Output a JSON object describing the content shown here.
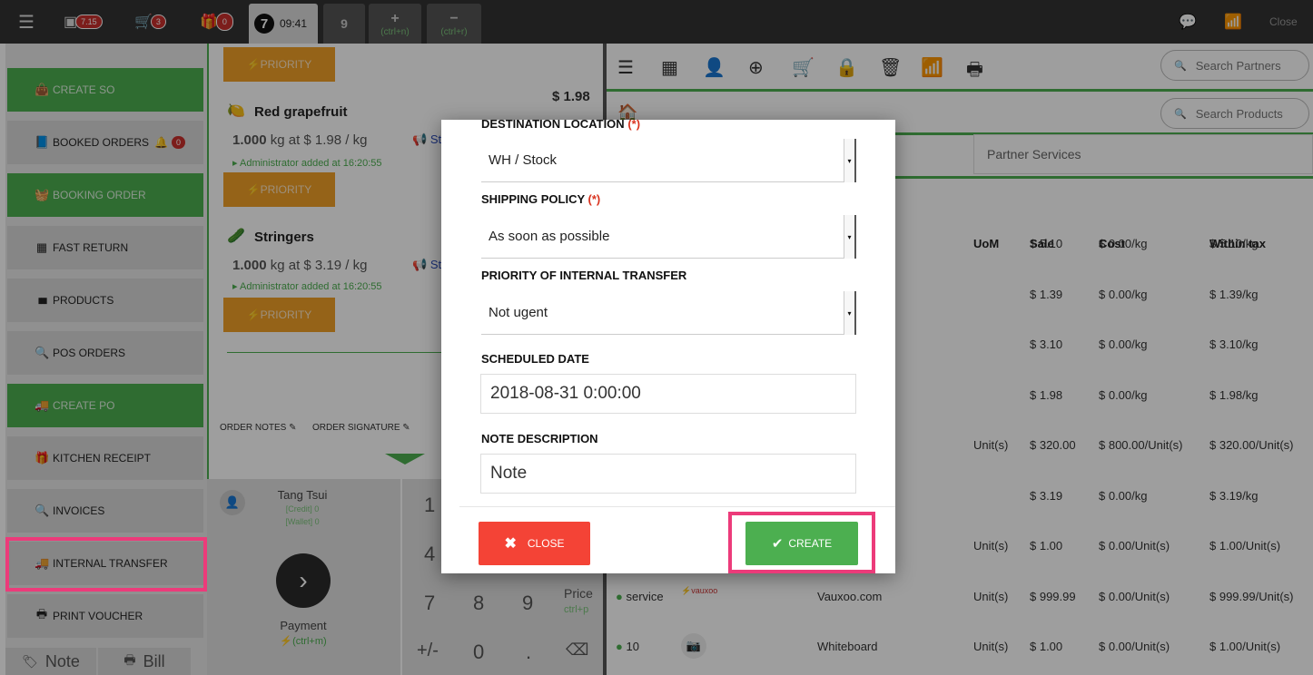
{
  "topbar": {
    "cash_badge": "7.15",
    "cart_badge": "3",
    "gift_badge": "0",
    "order_number": "7",
    "order_time": "09:41",
    "order_tab_2": "9",
    "add_shortcut": "(ctrl+n)",
    "remove_shortcut": "(ctrl+r)",
    "close_label": "Close"
  },
  "sidebar": {
    "items": [
      {
        "label": "CREATE SO",
        "icon": "shopping-bag-icon",
        "glyph": "👜"
      },
      {
        "label": "BOOKED ORDERS",
        "icon": "book-icon",
        "glyph": "📘"
      },
      {
        "label": "BOOKING ORDER",
        "icon": "basket-icon",
        "glyph": "🧺"
      },
      {
        "label": "FAST RETURN",
        "icon": "building-icon",
        "glyph": "▦"
      },
      {
        "label": "PRODUCTS",
        "icon": "barcode-icon",
        "glyph": "▮▮▮"
      },
      {
        "label": "POS ORDERS",
        "icon": "search-icon",
        "glyph": "🔍"
      },
      {
        "label": "CREATE PO",
        "icon": "truck-icon",
        "glyph": "🚚"
      },
      {
        "label": "KITCHEN RECEIPT",
        "icon": "gift-icon",
        "glyph": "🎁"
      },
      {
        "label": "INVOICES",
        "icon": "search-icon",
        "glyph": "🔍"
      },
      {
        "label": "INTERNAL TRANSFER",
        "icon": "truck-icon",
        "glyph": "🚚"
      },
      {
        "label": "PRINT VOUCHER",
        "icon": "print-icon",
        "glyph": "🖶"
      }
    ],
    "booked_badge": "0",
    "note_label": "Note",
    "bill_label": "Bill"
  },
  "order": {
    "priority_label": "PRIORITY",
    "total": "$ 1.98",
    "lines": [
      {
        "name": "Red grapefruit",
        "qty": "1.000",
        "unit_text": "kg at $ 1.98 / kg",
        "admin": "Administrator added at 16:20:55",
        "status": "Sta"
      },
      {
        "name": "Stringers",
        "qty": "1.000",
        "unit_text": "kg at $ 3.19 / kg",
        "admin": "Administrator added at 16:20:55",
        "status": "Sta"
      }
    ],
    "order_notes": "ORDER NOTES",
    "order_signature": "ORDER SIGNATURE"
  },
  "customer": {
    "name": "Tang Tsui",
    "credit": "[Credit] 0",
    "wallet": "[Wallet] 0",
    "payment_label": "Payment",
    "payment_shortcut": "(ctrl+m)"
  },
  "numpad": {
    "keys": [
      "1",
      "4",
      "7",
      "8",
      "9",
      "+/-",
      "0",
      "."
    ],
    "price_label": "Price",
    "price_shortcut": "ctrl+p"
  },
  "right": {
    "search_partners": "Search Partners",
    "search_products": "Search Products",
    "partner_services": "Partner Services",
    "columns": [
      "UoM",
      "Sale",
      "Cost",
      "Within tax"
    ],
    "rows": [
      {
        "uom": "",
        "sale": "$ 5.10",
        "cost": "$ 0.00/kg",
        "tax": "$ 5.10/kg"
      },
      {
        "uom": "",
        "sale": "$ 1.39",
        "cost": "$ 0.00/kg",
        "tax": "$ 1.39/kg"
      },
      {
        "uom": "",
        "sale": "$ 3.10",
        "cost": "$ 0.00/kg",
        "tax": "$ 3.10/kg"
      },
      {
        "uom": "",
        "sale": "$ 1.98",
        "cost": "$ 0.00/kg",
        "tax": "$ 1.98/kg"
      },
      {
        "uom": "Unit(s)",
        "sale": "$ 320.00",
        "cost": "$ 800.00/Unit(s)",
        "tax": "$ 320.00/Unit(s)"
      },
      {
        "uom": "",
        "sale": "$ 3.19",
        "cost": "$ 0.00/kg",
        "tax": "$ 3.19/kg"
      },
      {
        "uom": "Unit(s)",
        "sale": "$ 1.00",
        "cost": "$ 0.00/Unit(s)",
        "tax": "$ 1.00/Unit(s)"
      },
      {
        "code": "service",
        "name": "Vauxoo.com",
        "uom": "Unit(s)",
        "sale": "$ 999.99",
        "cost": "$ 0.00/Unit(s)",
        "tax": "$ 999.99/Unit(s)"
      },
      {
        "code": "10",
        "name": "Whiteboard",
        "uom": "Unit(s)",
        "sale": "$ 1.00",
        "cost": "$ 0.00/Unit(s)",
        "tax": "$ 1.00/Unit(s)"
      }
    ]
  },
  "modal": {
    "destination_label": "DESTINATION LOCATION",
    "required_mark": "(*)",
    "destination_value": "WH / Stock",
    "shipping_label": "SHIPPING POLICY",
    "shipping_value": "As soon as possible",
    "priority_label": "PRIORITY OF INTERNAL TRANSFER",
    "priority_value": "Not ugent",
    "scheduled_label": "SCHEDULED DATE",
    "scheduled_value": "2018-08-31 0:00:00",
    "note_label": "NOTE DESCRIPTION",
    "note_placeholder": "Note",
    "close_label": "CLOSE",
    "create_label": "CREATE"
  },
  "colors": {
    "green": "#4caf50",
    "orange": "#f0a028",
    "red": "#f44336",
    "highlight": "#ec3b7a"
  }
}
